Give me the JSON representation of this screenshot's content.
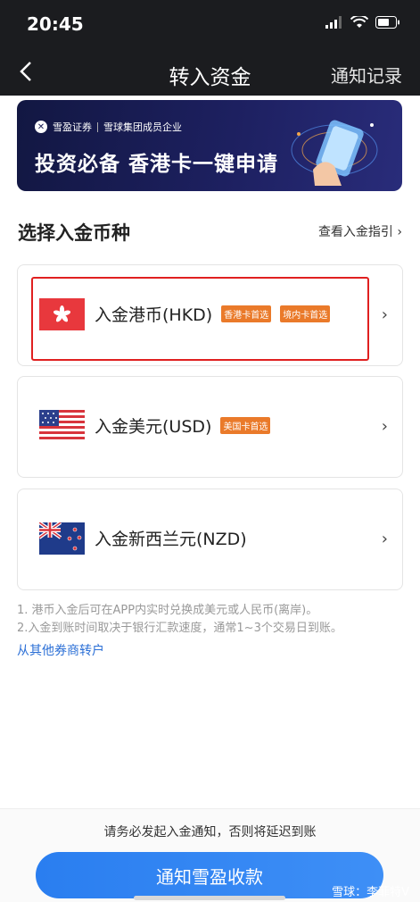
{
  "status_bar": {
    "time": "20:45"
  },
  "nav": {
    "back_icon": "chevron-left-icon",
    "title": "转入资金",
    "right_link": "通知记录"
  },
  "banner": {
    "brand": "雪盈证券",
    "brand_sub": "雪球集团成员企业",
    "headline": "投资必备 香港卡一键申请"
  },
  "section": {
    "title": "选择入金币种",
    "guide_link": "查看入金指引"
  },
  "currencies": [
    {
      "label": "入金港币(HKD)",
      "tags": [
        "香港卡首选",
        "境内卡首选"
      ],
      "flag": "hk-flag-icon"
    },
    {
      "label": "入金美元(USD)",
      "tags": [
        "美国卡首选"
      ],
      "flag": "us-flag-icon"
    },
    {
      "label": "入金新西兰元(NZD)",
      "tags": [],
      "flag": "nz-flag-icon"
    }
  ],
  "notes": {
    "line1": "1. 港币入金后可在APP内实时兑换成美元或人民币(离岸)。",
    "line2": "2.入金到账时间取决于银行汇款速度，通常1~3个交易日到账。",
    "link": "从其他券商转户"
  },
  "footer": {
    "hint": "请务必发起入金通知，否则将延迟到账",
    "button": "通知雪盈收款",
    "watermark": "雪球：李菲特V"
  },
  "colors": {
    "tag": "#ea7a2a",
    "primary": "#3189f3",
    "highlight": "#e02020"
  }
}
